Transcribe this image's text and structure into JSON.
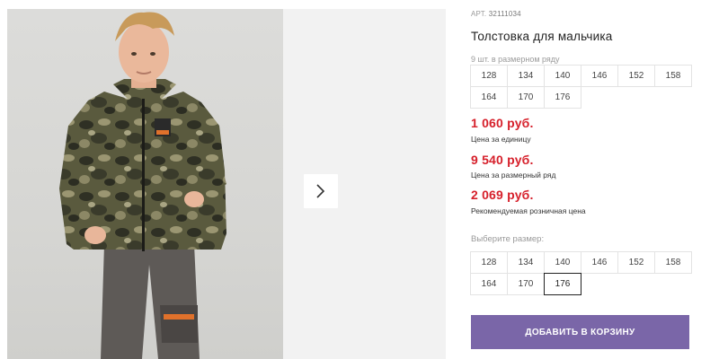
{
  "product": {
    "article_label": "АРТ.",
    "article_value": "32111034",
    "title": "Толстовка для мальчика",
    "row_note": "9 шт. в размерном ряду",
    "row_sizes": [
      "128",
      "134",
      "140",
      "146",
      "152",
      "158",
      "164",
      "170",
      "176"
    ],
    "prices": [
      {
        "value": "1 060 руб.",
        "caption": "Цена за единицу"
      },
      {
        "value": "9 540 руб.",
        "caption": "Цена за размерный ряд"
      },
      {
        "value": "2 069 руб.",
        "caption": "Рекомендуемая розничная цена"
      }
    ],
    "choose_label": "Выберите размер:",
    "select_sizes": [
      "128",
      "134",
      "140",
      "146",
      "152",
      "158",
      "164",
      "170",
      "176"
    ],
    "selected_size": "176",
    "add_to_cart_label": "ДОБАВИТЬ В КОРЗИНУ"
  },
  "gallery": {
    "next_icon": "chevron-right-icon",
    "photo_subject": "product-photo"
  },
  "colors": {
    "price": "#d6202b",
    "button": "#7a66a8",
    "selected_border": "#222222"
  }
}
